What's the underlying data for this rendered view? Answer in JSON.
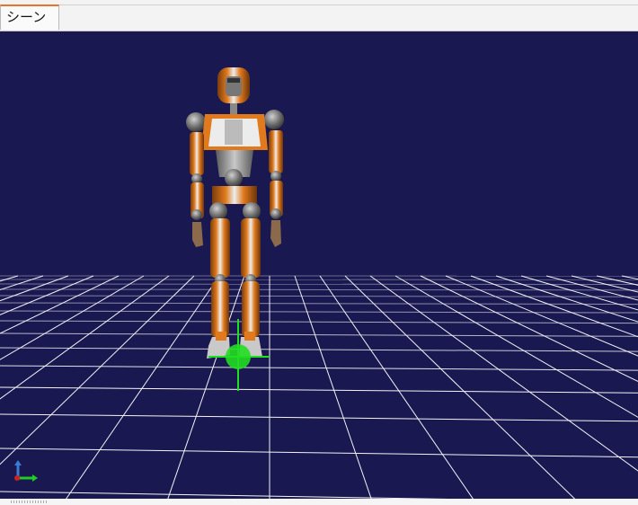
{
  "tabs": [
    {
      "label": "シーン"
    }
  ],
  "scene": {
    "background_color": "#1a1850",
    "grid_color": "#ffffff",
    "robot_primary_color": "#e07a1c",
    "robot_secondary_color": "#d9d9d9",
    "robot_joint_color": "#7a7a7a",
    "marker_color": "#22dd22",
    "axis_colors": {
      "x": "#22cc22",
      "y": "#3a7bd5",
      "z": "#cc2222"
    }
  }
}
